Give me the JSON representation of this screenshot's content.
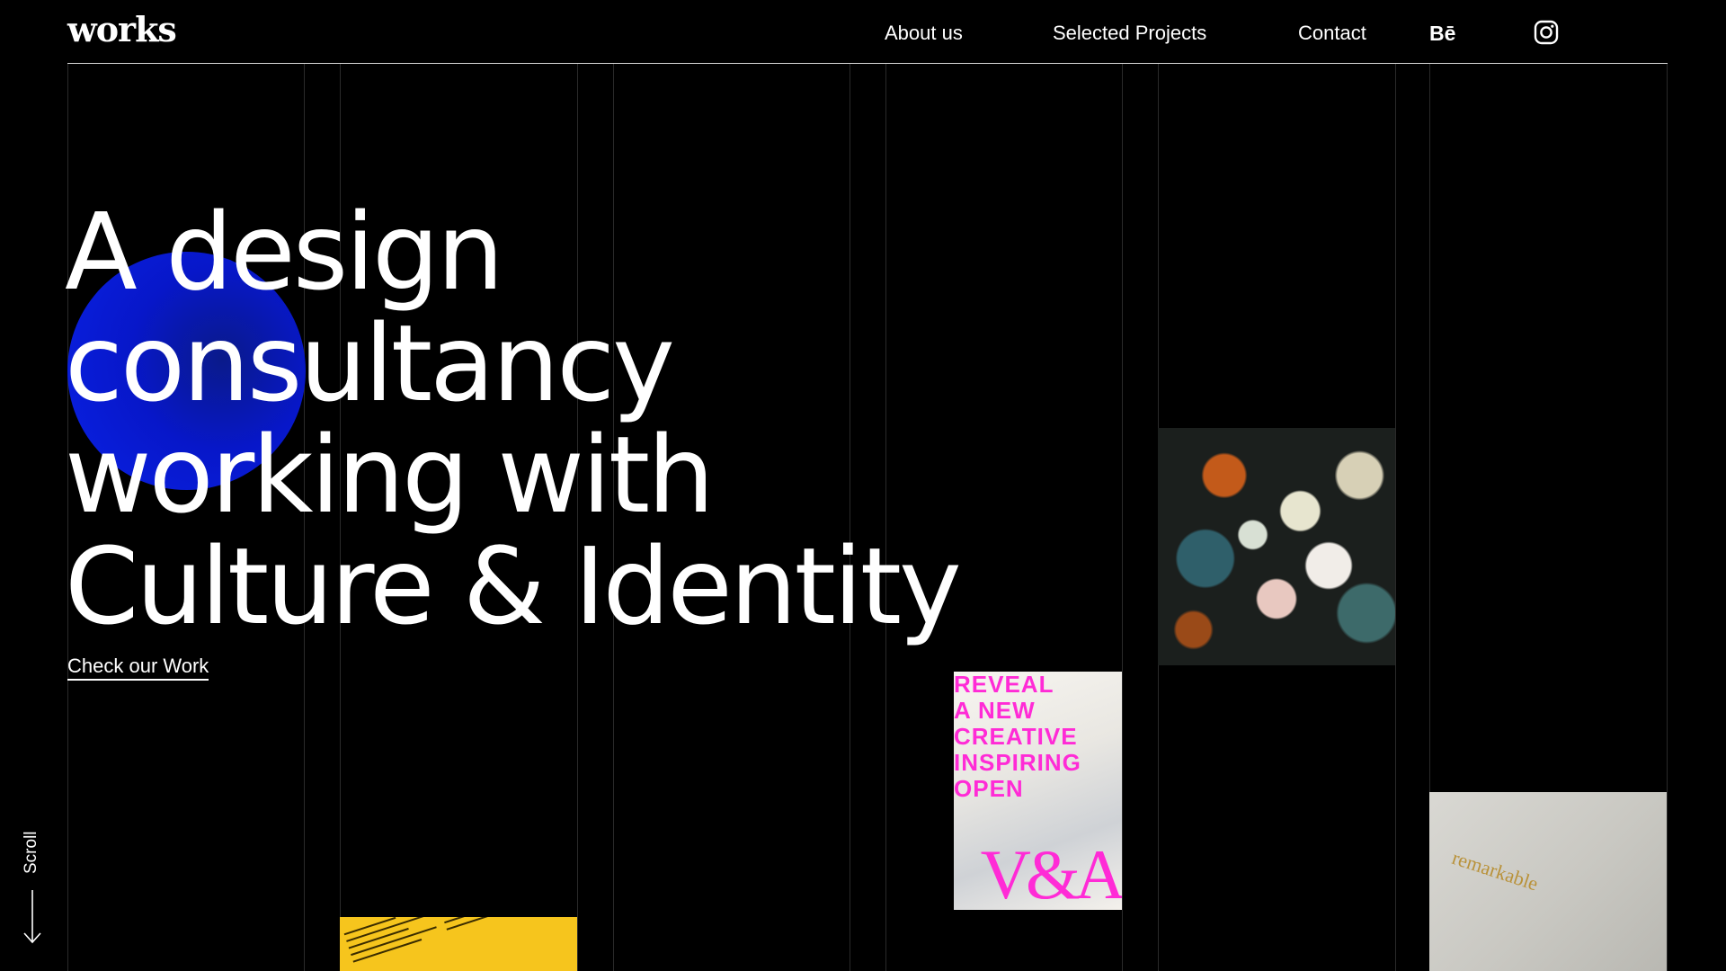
{
  "header": {
    "logo": "works",
    "nav": [
      {
        "label": "About us"
      },
      {
        "label": "Selected Projects"
      },
      {
        "label": "Contact"
      }
    ],
    "social": {
      "behance_label": "Bē",
      "instagram_icon": "instagram-icon"
    }
  },
  "hero": {
    "headline_lines": [
      "A design",
      "consultancy",
      "working with",
      "Culture & Identity"
    ],
    "cta_label": "Check our Work",
    "accent_color": "#0a1fe0"
  },
  "scroll": {
    "label": "Scroll",
    "icon": "arrow-down-icon"
  },
  "projects": {
    "va": {
      "headline_lines": [
        "REVEAL",
        "A     NEW",
        "CREATIVE",
        "INSPIRING",
        "OPEN"
      ],
      "logo": "V&A",
      "accent_color": "#ff2bd6"
    },
    "remark": {
      "text": "remarkable"
    }
  },
  "colors": {
    "background": "#000000",
    "text": "#ffffff",
    "divider": "#d8d8d8"
  }
}
